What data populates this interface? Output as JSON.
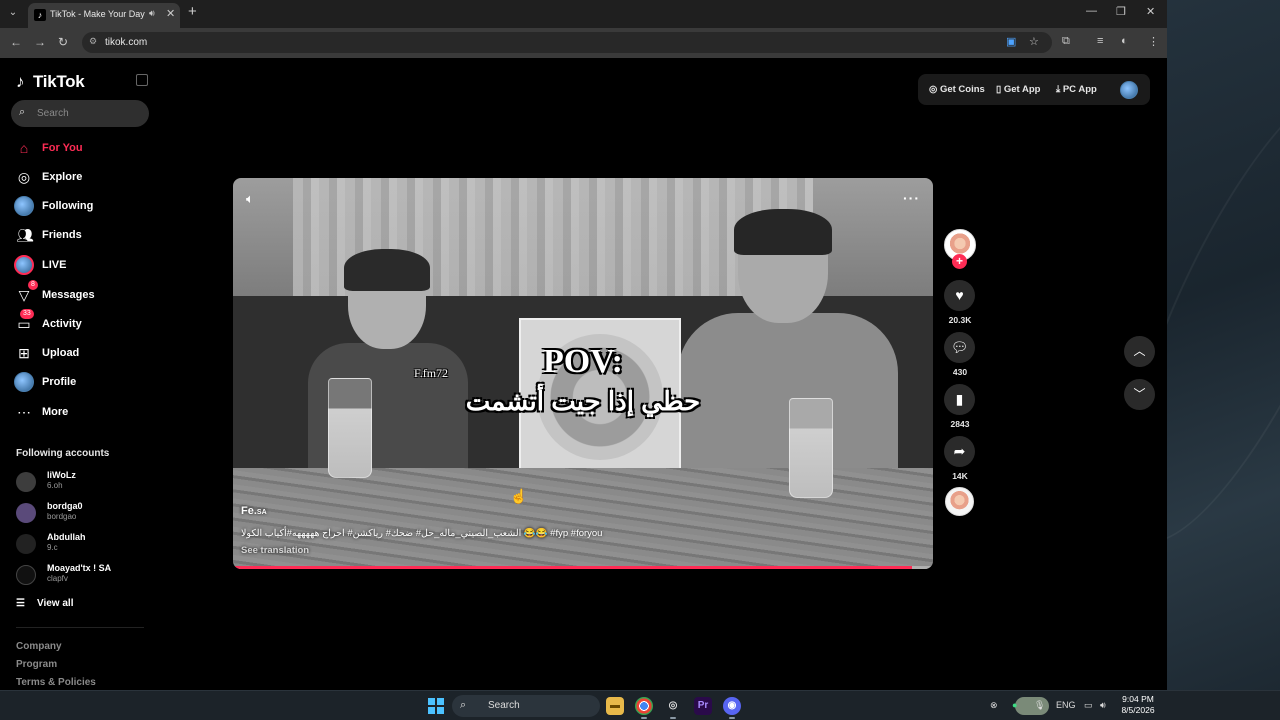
{
  "browser": {
    "tab_title": "TikTok - Make Your Day",
    "url": "tikok.com"
  },
  "sidebar": {
    "logo": "TikTok",
    "search_placeholder": "Search",
    "nav": [
      {
        "label": "For You",
        "icon": "home-icon",
        "active": true
      },
      {
        "label": "Explore",
        "icon": "compass-icon"
      },
      {
        "label": "Following",
        "icon": "following-avatar-icon"
      },
      {
        "label": "Friends",
        "icon": "friends-icon"
      },
      {
        "label": "LIVE",
        "icon": "live-icon"
      },
      {
        "label": "Messages",
        "icon": "send-icon",
        "badge": "8"
      },
      {
        "label": "Activity",
        "icon": "activity-icon",
        "badge": "33"
      },
      {
        "label": "Upload",
        "icon": "upload-icon"
      },
      {
        "label": "Profile",
        "icon": "profile-avatar-icon"
      },
      {
        "label": "More",
        "icon": "more-icon"
      }
    ],
    "following_title": "Following accounts",
    "accounts": [
      {
        "name": "liWoLz",
        "sub": "6.oh"
      },
      {
        "name": "bordga0",
        "sub": "bordgao"
      },
      {
        "name": "Abdullah",
        "sub": "9.c"
      },
      {
        "name": "Moayad'tx ! SA",
        "sub": "clapfv"
      }
    ],
    "view_all": "View all",
    "footer": [
      "Company",
      "Program",
      "Terms & Policies"
    ]
  },
  "top_actions": {
    "get_coins": "Get Coins",
    "get_app": "Get App",
    "pc_app": "PC App"
  },
  "video": {
    "caption_pov": "POV:",
    "caption_ar": "حظي إذا جيت أتشمت",
    "watermark": "F.fm72",
    "author": "Fe.",
    "author_suffix": "SA",
    "description": "الشعب_الصيني_ماله_حل# ضحك# رياكشن# احراج هههههه#أكياب الكولا 😂😂 #fyp #foryou",
    "see_translation": "See translation",
    "progress": 0.97
  },
  "actions": {
    "likes": "20.3K",
    "comments": "430",
    "saves": "2843",
    "shares": "14K"
  },
  "taskbar": {
    "search": "Search",
    "lang": "ENG",
    "time": "9:04 PM",
    "date": "8/5/2026"
  }
}
